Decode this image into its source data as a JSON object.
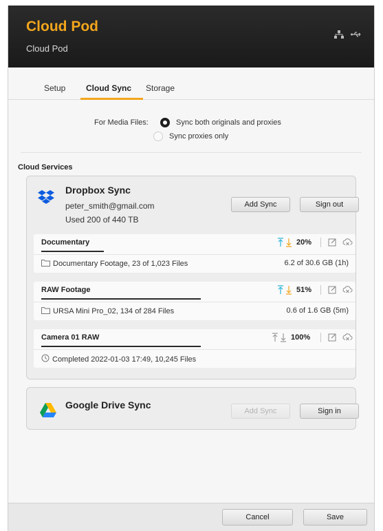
{
  "header": {
    "title": "Cloud Pod",
    "subtitle": "Cloud Pod",
    "icons": [
      "network-icon",
      "usb-icon"
    ]
  },
  "tabs": [
    {
      "label": "Setup",
      "active": false
    },
    {
      "label": "Cloud Sync",
      "active": true
    },
    {
      "label": "Storage",
      "active": false
    }
  ],
  "media_files": {
    "label": "For Media Files:",
    "options": [
      {
        "label": "Sync both originals and proxies",
        "selected": true
      },
      {
        "label": "Sync proxies only",
        "selected": false
      }
    ]
  },
  "cloud_services": {
    "title": "Cloud Services",
    "dropbox": {
      "name": "Dropbox Sync",
      "email": "peter_smith@gmail.com",
      "used": "Used 200 of 440 TB",
      "add_sync": "Add Sync",
      "sign_out": "Sign out",
      "syncs": [
        {
          "title": "Documentary",
          "percent": "20%",
          "progress": 0.2,
          "active": true,
          "detail_icon": "folder-icon",
          "detail": "Documentary Footage,  23 of 1,023 Files",
          "size": "6.2 of 30.6 GB (1h)"
        },
        {
          "title": "RAW Footage",
          "percent": "51%",
          "progress": 0.51,
          "active": true,
          "detail_icon": "folder-icon",
          "detail": "URSA Mini Pro_02,  134 of 284 Files",
          "size": "0.6 of 1.6 GB (5m)"
        },
        {
          "title": "Camera 01 RAW",
          "percent": "100%",
          "progress": 1.0,
          "active": false,
          "detail_icon": "clock-icon",
          "detail": "Completed 2022-01-03 17:49, 10,245 Files",
          "size": ""
        }
      ]
    },
    "google_drive": {
      "name": "Google Drive Sync",
      "add_sync": "Add Sync",
      "add_sync_enabled": false,
      "sign_in": "Sign in"
    }
  },
  "footer": {
    "cancel": "Cancel",
    "save": "Save"
  },
  "colors": {
    "accent": "#f2a51c",
    "upload_arrow": "#2bb5d8",
    "download_arrow": "#f2a51c",
    "dropbox_blue": "#0d5ce0"
  }
}
